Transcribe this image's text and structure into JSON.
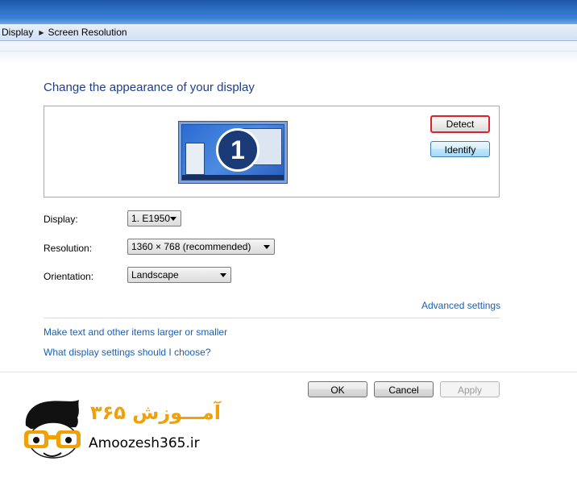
{
  "breadcrumb": {
    "items": [
      "Display",
      "Screen Resolution"
    ]
  },
  "heading": "Change the appearance of your display",
  "monitor": {
    "number": "1"
  },
  "buttons": {
    "detect": "Detect",
    "identify": "Identify",
    "ok": "OK",
    "cancel": "Cancel",
    "apply": "Apply"
  },
  "settings": {
    "display_label": "Display:",
    "display_value": "1. E1950",
    "resolution_label": "Resolution:",
    "resolution_value": "1360 × 768 (recommended)",
    "orientation_label": "Orientation:",
    "orientation_value": "Landscape"
  },
  "links": {
    "advanced": "Advanced settings",
    "text_size": "Make text and other items larger or smaller",
    "which_settings": "What display settings should I choose?"
  },
  "watermark": {
    "persian": "آمـــوزش ۳۶۵",
    "site": "Amoozesh365.ir"
  },
  "colors": {
    "heading": "#1e3e8c",
    "link": "#1a5fb4",
    "detect_highlight": "#e0202a",
    "logo_accent": "#f2a007"
  },
  "icons": [
    "breadcrumb-arrow-icon",
    "dropdown-arrow-icon",
    "monitor-icon",
    "mascot-glasses-icon"
  ]
}
